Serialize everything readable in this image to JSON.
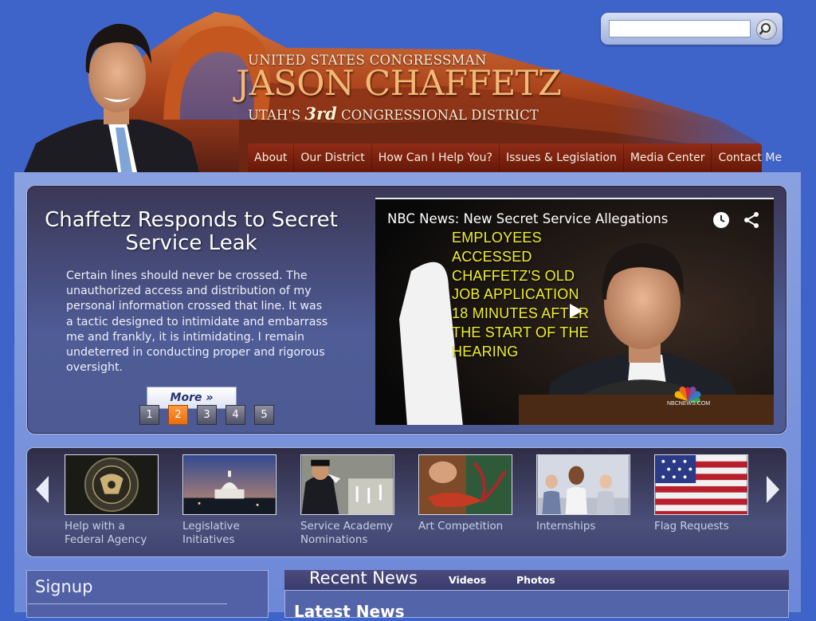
{
  "header": {
    "title_small": "UNITED STATES CONGRESSMAN",
    "title_name": "JASON CHAFFETZ",
    "title_district_prefix": "UTAH'S",
    "title_district_ordinal": "3rd",
    "title_district_suffix": "CONGRESSIONAL DISTRICT"
  },
  "search": {
    "value": "",
    "placeholder": ""
  },
  "nav": {
    "items": [
      {
        "label": "About"
      },
      {
        "label": "Our District"
      },
      {
        "label": "How Can I Help You?"
      },
      {
        "label": "Issues & Legislation"
      },
      {
        "label": "Media Center"
      },
      {
        "label": "Contact Me"
      }
    ]
  },
  "feature": {
    "title": "Chaffetz Responds to Secret Service Leak",
    "text": "Certain lines should never be crossed. The unauthorized access and distribution of my personal information crossed that line. It was a tactic designed to intimidate and embarrass me and frankly, it is intimidating. I remain undeterred in conducting proper and rigorous oversight.",
    "more_label": "More »",
    "pager": [
      "1",
      "2",
      "3",
      "4",
      "5"
    ],
    "active_page": "2"
  },
  "video": {
    "title": "NBC News: New Secret Service Allegations",
    "overlay_lines": [
      "EMPLOYEES",
      "ACCESSED",
      "CHAFFETZ'S OLD",
      "JOB APPLICATION",
      "18 MINUTES AFTER",
      "THE START OF THE",
      "HEARING"
    ],
    "watermark": "NBCNEWS.COM"
  },
  "quick_links": [
    {
      "label": "Help with a Federal Agency"
    },
    {
      "label": "Legislative Initiatives"
    },
    {
      "label": "Service Academy Nominations"
    },
    {
      "label": "Art Competition"
    },
    {
      "label": "Internships"
    },
    {
      "label": "Flag Requests"
    }
  ],
  "signup": {
    "title": "Signup"
  },
  "news": {
    "title": "Recent News",
    "tabs": [
      "Videos",
      "Photos"
    ],
    "latest": "Latest News"
  },
  "colors": {
    "page_bg": "#3f64c9",
    "nav_bg": "#7a2010",
    "pager_active": "#f07e22",
    "overlay_text": "#f0f02a"
  }
}
